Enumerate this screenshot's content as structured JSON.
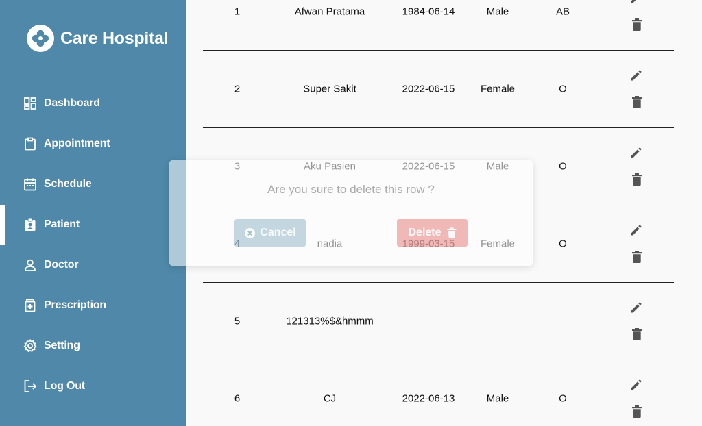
{
  "app": {
    "name": "Care Hospital",
    "logo_icon": "hospital-logo-icon"
  },
  "sidebar": {
    "items": [
      {
        "label": "Dashboard",
        "icon": "dashboard-icon",
        "active": false
      },
      {
        "label": "Appointment",
        "icon": "clipboard-icon",
        "active": false
      },
      {
        "label": "Schedule",
        "icon": "calendar-icon",
        "active": false
      },
      {
        "label": "Patient",
        "icon": "patient-badge-icon",
        "active": true
      },
      {
        "label": "Doctor",
        "icon": "person-icon",
        "active": false
      },
      {
        "label": "Prescription",
        "icon": "medicine-icon",
        "active": false
      },
      {
        "label": "Setting",
        "icon": "gear-icon",
        "active": false
      },
      {
        "label": "Log Out",
        "icon": "logout-icon",
        "active": false
      }
    ]
  },
  "table": {
    "rows": [
      {
        "no": "1",
        "name": "Afwan Pratama",
        "dob": "1984-06-14",
        "gender": "Male",
        "blood": "AB"
      },
      {
        "no": "2",
        "name": "Super Sakit",
        "dob": "2022-06-15",
        "gender": "Female",
        "blood": "O"
      },
      {
        "no": "3",
        "name": "Aku Pasien",
        "dob": "2022-06-15",
        "gender": "Male",
        "blood": "O"
      },
      {
        "no": "4",
        "name": "nadia",
        "dob": "1999-03-15",
        "gender": "Female",
        "blood": "O"
      },
      {
        "no": "5",
        "name": "121313%$&hmmm",
        "dob": "",
        "gender": "",
        "blood": ""
      },
      {
        "no": "6",
        "name": "CJ",
        "dob": "2022-06-13",
        "gender": "Male",
        "blood": "O"
      }
    ],
    "edit_icon": "pencil-icon",
    "delete_icon": "trash-icon"
  },
  "dialog": {
    "message": "Are you sure to delete this row ?",
    "cancel_label": "Cancel",
    "delete_label": "Delete",
    "cancel_icon": "close-circle-icon",
    "delete_icon": "trash-icon"
  },
  "colors": {
    "sidebar": "#4f88a8",
    "delete": "#e25a5a",
    "icon_gray": "#555555"
  }
}
